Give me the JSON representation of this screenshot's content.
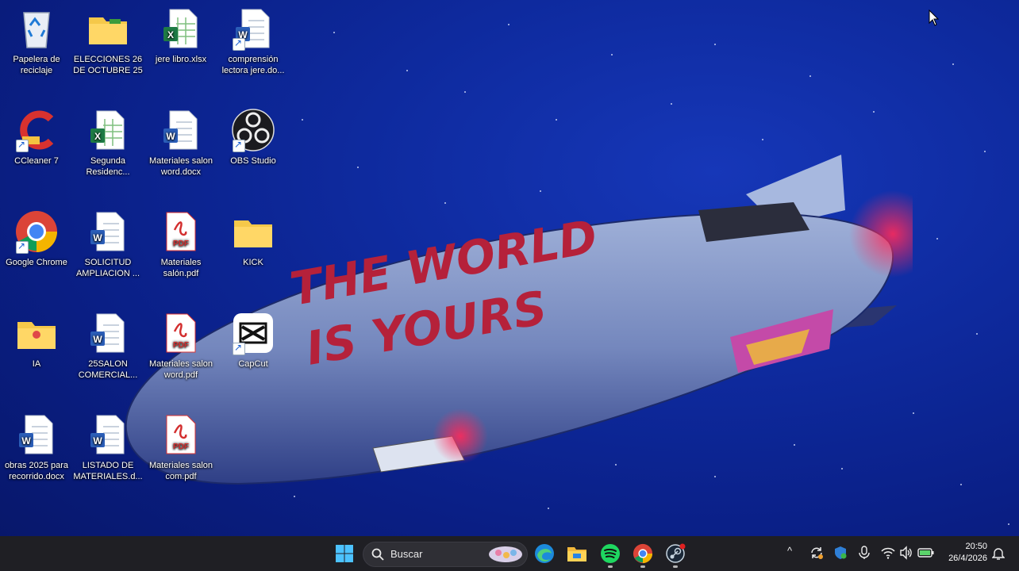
{
  "desktop": {
    "icons": [
      {
        "label": "Papelera de reciclaje",
        "icon": "recycle-bin-icon"
      },
      {
        "label": "ELECCIONES 26 DE OCTUBRE 25",
        "icon": "folder-icon"
      },
      {
        "label": "jere libro.xlsx",
        "icon": "excel-file-icon"
      },
      {
        "label": "comprensión lectora jere.do...",
        "icon": "word-file-icon"
      },
      {
        "label": "CCleaner 7",
        "icon": "ccleaner-icon"
      },
      {
        "label": "Segunda Residenc...",
        "icon": "excel-file-icon"
      },
      {
        "label": "Materiales salon word.docx",
        "icon": "word-file-icon"
      },
      {
        "label": "OBS Studio",
        "icon": "obs-icon"
      },
      {
        "label": "Google Chrome",
        "icon": "chrome-icon"
      },
      {
        "label": "SOLICITUD AMPLIACION ...",
        "icon": "word-file-icon"
      },
      {
        "label": "Materiales salón.pdf",
        "icon": "pdf-file-icon"
      },
      {
        "label": "KICK",
        "icon": "folder-icon"
      },
      {
        "label": "IA",
        "icon": "folder-icon"
      },
      {
        "label": "25SALON COMERCIAL...",
        "icon": "word-file-icon"
      },
      {
        "label": "Materiales salon word.pdf",
        "icon": "pdf-file-icon"
      },
      {
        "label": "CapCut",
        "icon": "capcut-icon"
      },
      {
        "label": "obras 2025 para recorrido.docx",
        "icon": "word-file-icon"
      },
      {
        "label": "LISTADO DE MATERIALES.d...",
        "icon": "word-file-icon"
      },
      {
        "label": "Materiales salon com.pdf",
        "icon": "pdf-file-icon"
      }
    ]
  },
  "wallpaper": {
    "line1": "THE WORLD",
    "line2": "IS YOURS"
  },
  "taskbar": {
    "search_label": "Buscar",
    "apps": [
      "start-icon",
      "edge-icon",
      "file-explorer-icon",
      "spotify-icon",
      "chrome-icon",
      "steam-icon"
    ],
    "clock": {
      "time": "20:50",
      "date": "26/4/2026"
    }
  },
  "colors": {
    "desktop_blue": "#0e2a9e",
    "taskbar": "#1f1f24",
    "graffiti_red": "#b5213a"
  }
}
